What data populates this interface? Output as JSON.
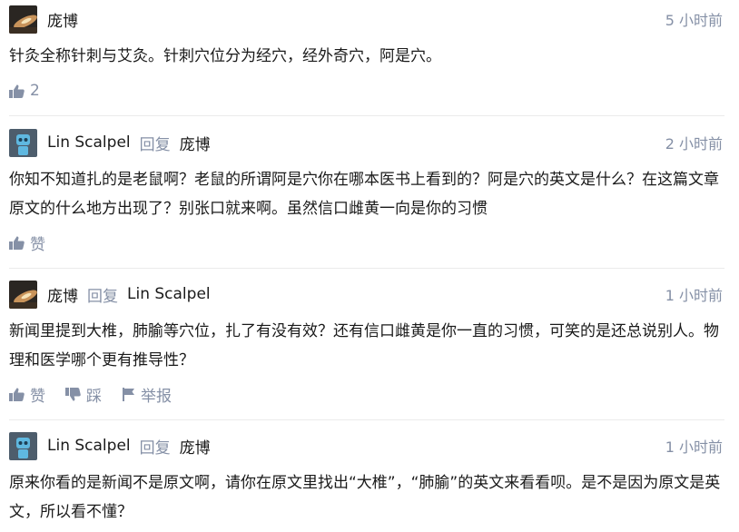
{
  "comments": [
    {
      "author": "庞博",
      "avatar": "sunset-avatar",
      "reply_word": "",
      "reply_to": "",
      "time": "5 小时前",
      "text": "针灸全称针刺与艾灸。针刺穴位分为经穴，经外奇穴，阿是穴。",
      "like_label": "2"
    },
    {
      "author": "Lin Scalpel",
      "avatar": "robot-avatar",
      "reply_word": "回复",
      "reply_to": "庞博",
      "time": "2 小时前",
      "text": "你知不知道扎的是老鼠啊？老鼠的所谓阿是穴你在哪本医书上看到的？阿是穴的英文是什么？在这篇文章原文的什么地方出现了？别张口就来啊。虽然信口雌黄一向是你的习惯",
      "like_label": "赞"
    },
    {
      "author": "庞博",
      "avatar": "sunset-avatar",
      "reply_word": "回复",
      "reply_to": "Lin Scalpel",
      "time": "1 小时前",
      "text": "新闻里提到大椎，肺腧等穴位，扎了有没有效？还有信口雌黄是你一直的习惯，可笑的是还总说别人。物理和医学哪个更有推导性？",
      "like_label": "赞",
      "dislike_label": "踩",
      "report_label": "举报"
    },
    {
      "author": "Lin Scalpel",
      "avatar": "robot-avatar",
      "reply_word": "回复",
      "reply_to": "庞博",
      "time": "1 小时前",
      "text": "原来你看的是新闻不是原文啊，请你在原文里找出“大椎”，“肺腧”的英文来看看呗。是不是因为原文是英文，所以看不懂？"
    }
  ]
}
